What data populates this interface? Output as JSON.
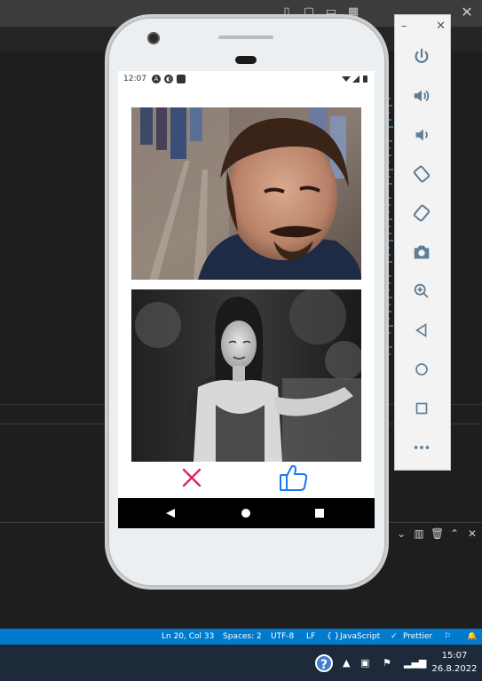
{
  "vscode": {
    "statusbar": {
      "position": "Ln 20, Col 33",
      "spaces": "Spaces: 2",
      "encoding": "UTF-8",
      "eol": "LF",
      "language": "JavaScript",
      "formatter": "Prettier"
    }
  },
  "taskbar": {
    "time": "15:07",
    "date": "26.8.2022"
  },
  "emulator": {
    "window_controls": [
      "minimize",
      "close"
    ],
    "buttons": [
      "power-icon",
      "volume-up-icon",
      "volume-down-icon",
      "rotate-left-icon",
      "rotate-right-icon",
      "camera-icon",
      "zoom-icon",
      "back-icon",
      "home-icon",
      "overview-icon",
      "more-icon"
    ]
  },
  "phone": {
    "statusbar": {
      "time": "12:07"
    },
    "photos": [
      {
        "name": "man-selfie-photo"
      },
      {
        "name": "woman-bw-photo"
      }
    ],
    "actions": {
      "dislike_icon": "close-icon",
      "like_icon": "thumbs-up-icon",
      "dislike_color": "#e0245e",
      "like_color": "#1877f2"
    }
  }
}
